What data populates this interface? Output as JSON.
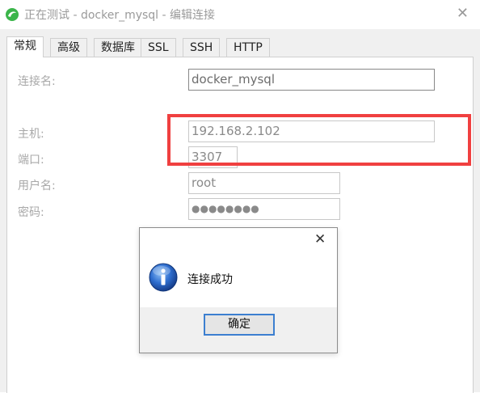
{
  "window": {
    "title": "正在测试 - docker_mysql - 编辑连接",
    "close_glyph": "✕"
  },
  "tabs": [
    {
      "label": "常规",
      "active": true
    },
    {
      "label": "高级",
      "active": false
    },
    {
      "label": "数据库",
      "active": false
    },
    {
      "label": "SSL",
      "active": false
    },
    {
      "label": "SSH",
      "active": false
    },
    {
      "label": "HTTP",
      "active": false
    }
  ],
  "form": {
    "connection_name_label": "连接名:",
    "connection_name_value": "docker_mysql",
    "host_label": "主机:",
    "host_value": "192.168.2.102",
    "port_label": "端口:",
    "port_value": "3307",
    "username_label": "用户名:",
    "username_value": "root",
    "password_label": "密码:",
    "password_value": "●●●●●●●●"
  },
  "annotation": {
    "highlight_color": "#f04040"
  },
  "dialog": {
    "close_glyph": "✕",
    "icon": "info-icon",
    "message": "连接成功",
    "ok_label": "确定",
    "accent_color": "#3c7fd0"
  }
}
